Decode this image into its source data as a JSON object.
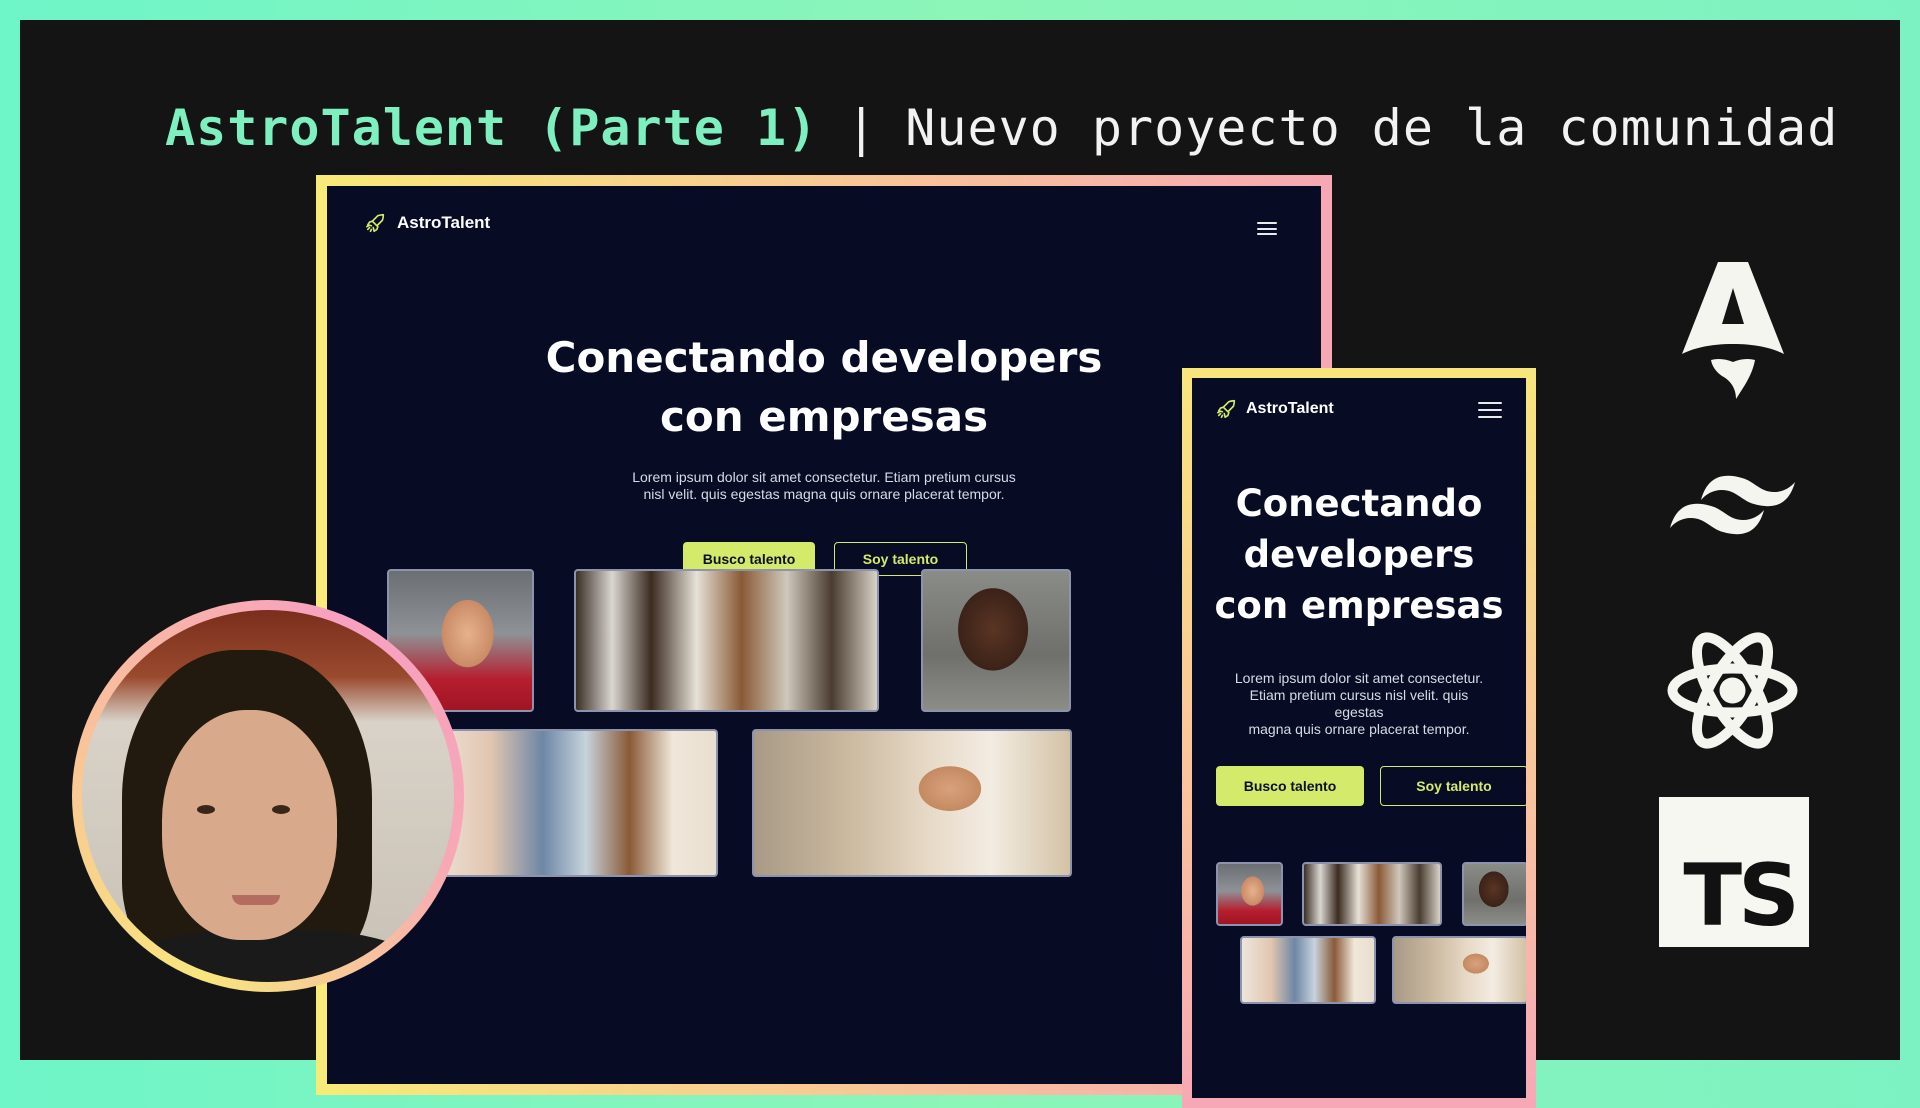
{
  "headline": {
    "accent": "AstroTalent (Parte 1)",
    "separator": "|",
    "rest": "Nuevo proyecto de la comunidad"
  },
  "site": {
    "brand": "AstroTalent",
    "hero_title_line1": "Conectando developers",
    "hero_title_line2": "con empresas",
    "hero_text_line1": "Lorem ipsum dolor sit amet consectetur. Etiam pretium cursus",
    "hero_text_line2": "nisl velit. quis egestas magna quis ornare placerat tempor.",
    "primary_button": "Busco talento",
    "secondary_button": "Soy talento"
  },
  "mobile": {
    "hero_title_line1": "Conectando",
    "hero_title_line2": "developers",
    "hero_title_line3": "con empresas",
    "hero_text_line1": "Lorem ipsum dolor sit amet consectetur.",
    "hero_text_line2": "Etiam pretium cursus nisl velit. quis egestas",
    "hero_text_line3": "magna quis ornare placerat tempor."
  },
  "tech_icons": {
    "astro": "astro-icon",
    "tailwind": "tailwind-icon",
    "react": "react-icon",
    "typescript": "TS"
  },
  "colors": {
    "background": "#141414",
    "accent": "#7ef0c0",
    "site_bg": "#070c24",
    "button": "#d4ea6a"
  }
}
